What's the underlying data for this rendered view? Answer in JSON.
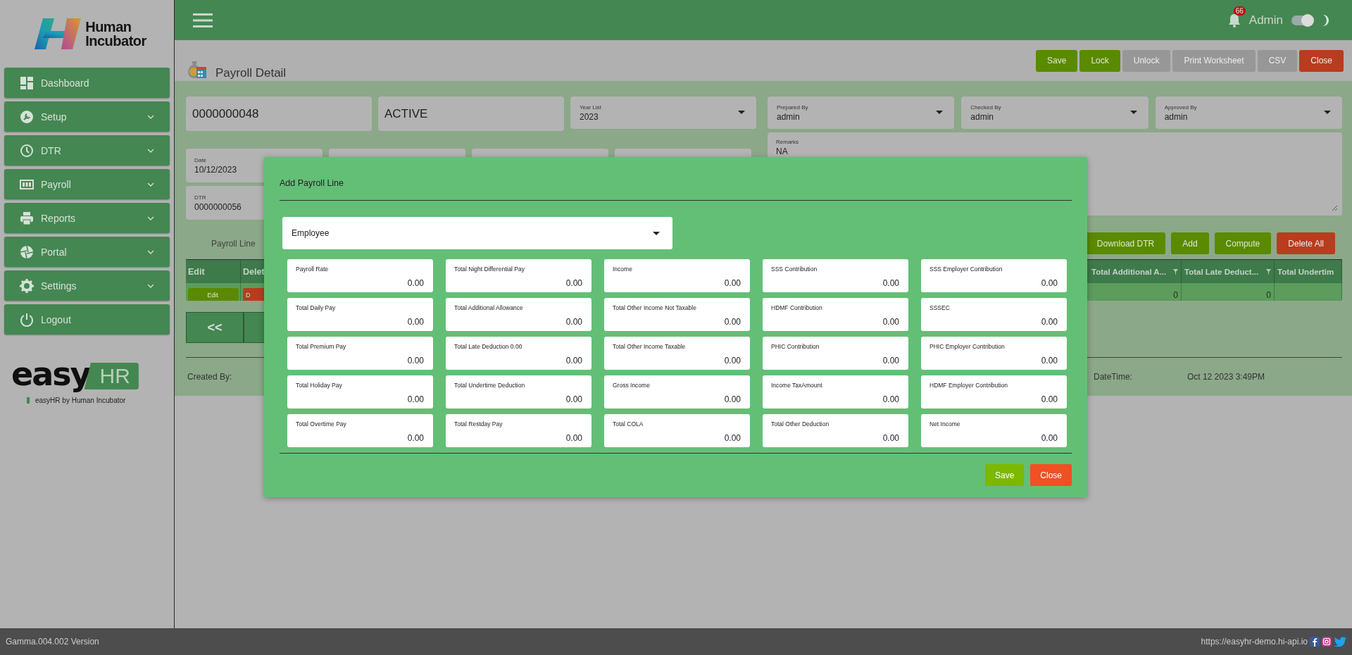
{
  "brand": {
    "name_line1": "Human",
    "name_line2": "Incubator"
  },
  "sidebar": {
    "items": [
      {
        "label": "Dashboard",
        "has_submenu": false
      },
      {
        "label": "Setup",
        "has_submenu": true
      },
      {
        "label": "DTR",
        "has_submenu": true
      },
      {
        "label": "Payroll",
        "has_submenu": true
      },
      {
        "label": "Reports",
        "has_submenu": true
      },
      {
        "label": "Portal",
        "has_submenu": true
      },
      {
        "label": "Settings",
        "has_submenu": true
      },
      {
        "label": "Logout",
        "has_submenu": false
      }
    ],
    "product_logo": {
      "part1": "easy",
      "part2": "HR"
    },
    "tagline": "easyHR by Human Incubator"
  },
  "topbar": {
    "notification_count": "66",
    "user": "Admin",
    "dark_mode_toggle": {
      "on": true
    }
  },
  "page": {
    "title": "Payroll Detail",
    "actions": [
      {
        "label": "Save",
        "kind": "primary",
        "disabled": false
      },
      {
        "label": "Lock",
        "kind": "primary",
        "disabled": false
      },
      {
        "label": "Unlock",
        "kind": "primary",
        "disabled": true
      },
      {
        "label": "Print Worksheet",
        "kind": "primary",
        "disabled": true
      },
      {
        "label": "CSV",
        "kind": "primary",
        "disabled": true
      },
      {
        "label": "Close",
        "kind": "danger",
        "disabled": false
      }
    ],
    "number": "0000000048",
    "status": "ACTIVE",
    "year_list": {
      "label": "Year List",
      "value": "2023"
    },
    "date": {
      "label": "Date",
      "value": "10/12/2023"
    },
    "dtr": {
      "label": "DTR",
      "value": "0000000056"
    },
    "signatories": [
      {
        "label": "Prepared By",
        "value": "admin"
      },
      {
        "label": "Checked By",
        "value": "admin"
      },
      {
        "label": "Approved By",
        "value": "admin"
      }
    ],
    "remarks": {
      "label": "Remarks",
      "value": "NA"
    },
    "tab": "Payroll Line",
    "line_actions": [
      {
        "label": "Download DTR",
        "kind": "primary"
      },
      {
        "label": "Add",
        "kind": "primary"
      },
      {
        "label": "Compute",
        "kind": "primary"
      },
      {
        "label": "Delete All",
        "kind": "danger"
      }
    ],
    "table": {
      "left_columns": [
        "Edit",
        "Delet"
      ],
      "right_columns": [
        "Total Additional A...",
        "Total Late Deduct...",
        "Total Undertim"
      ],
      "rows": [
        {
          "edit_button": "Edit",
          "delete_button": "D",
          "right_cells": [
            "0",
            "0",
            ""
          ]
        }
      ]
    },
    "pagination": {
      "first": "<<"
    },
    "created_by_label": "Created By:",
    "datetime_label": "DateTime:",
    "datetime_value": "Oct 12 2023 3:49PM"
  },
  "modal": {
    "title": "Add Payroll Line",
    "employee_placeholder": "Employee",
    "fields": [
      {
        "label": "Payroll Rate",
        "value": "0.00"
      },
      {
        "label": "Total Night Differential Pay",
        "value": "0.00"
      },
      {
        "label": "Income",
        "value": "0.00"
      },
      {
        "label": "SSS Contribution",
        "value": "0.00"
      },
      {
        "label": "SSS Employer Contribution",
        "value": "0.00"
      },
      {
        "label": "Total Daily Pay",
        "value": "0.00"
      },
      {
        "label": "Total Additional Allowance",
        "value": "0.00"
      },
      {
        "label": "Total Other Income Not Taxable",
        "value": "0.00"
      },
      {
        "label": "HDMF Contribution",
        "value": "0.00"
      },
      {
        "label": "SSSEC",
        "value": "0.00"
      },
      {
        "label": "Total Premium Pay",
        "value": "0.00"
      },
      {
        "label": "Total Late Deduction 0.00",
        "value": "0.00"
      },
      {
        "label": "Total Other Income Taxable",
        "value": "0.00"
      },
      {
        "label": "PHIC Contribution",
        "value": "0.00"
      },
      {
        "label": "PHIC Employer Contribution",
        "value": "0.00"
      },
      {
        "label": "Total Holiday Pay",
        "value": "0.00"
      },
      {
        "label": "Total Undertime Deduction",
        "value": "0.00"
      },
      {
        "label": "Gross Income",
        "value": "0.00"
      },
      {
        "label": "Income TaxAmount",
        "value": "0.00"
      },
      {
        "label": "HDMF Employer Contribution",
        "value": "0.00"
      },
      {
        "label": "Total Overtime Pay",
        "value": "0.00"
      },
      {
        "label": "Total Restday Pay",
        "value": "0.00"
      },
      {
        "label": "Total COLA",
        "value": "0.00"
      },
      {
        "label": "Total Other Deduction",
        "value": "0.00"
      },
      {
        "label": "Net Income",
        "value": "0.00"
      }
    ],
    "buttons": [
      {
        "label": "Save",
        "kind": "primary"
      },
      {
        "label": "Close",
        "kind": "danger"
      }
    ]
  },
  "footer": {
    "version": "Gamma.004.002 Version",
    "url": "https://easyhr-demo.hi-api.io"
  }
}
